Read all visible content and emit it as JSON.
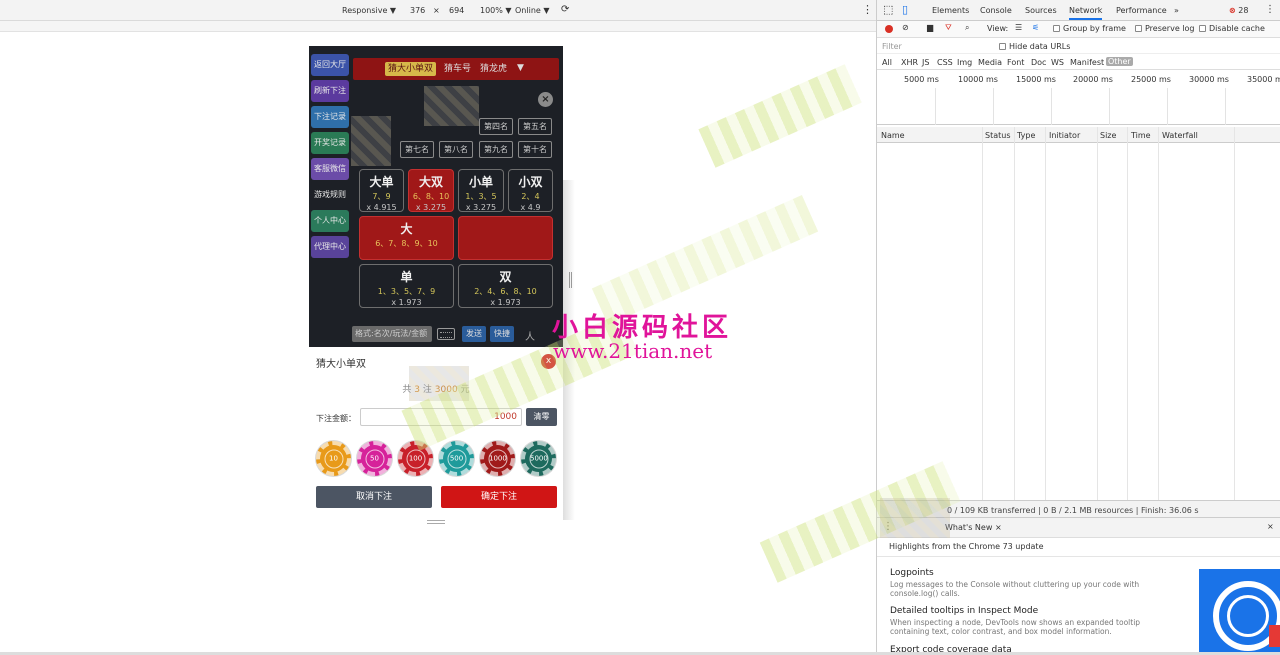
{
  "device_toolbar": {
    "mode": "Responsive ▼",
    "width": "376",
    "times": "×",
    "height": "694",
    "zoom": "100% ▼",
    "network": "Online ▼"
  },
  "game": {
    "side_menu": [
      "返回大厅",
      "刷新下注",
      "下注记录",
      "开奖记录",
      "客服微信",
      "游戏规则",
      "个人中心",
      "代理中心"
    ],
    "tabs": [
      "猜大小单双",
      "猜车号",
      "猜龙虎"
    ],
    "tab_caret": "▼",
    "close_label": "×",
    "ranks_row1": [
      "第四名",
      "第五名"
    ],
    "ranks_row2": [
      "第七名",
      "第八名",
      "第九名",
      "第十名"
    ],
    "cards": [
      {
        "title": "大单",
        "nums": "7、9",
        "odds": "x 4.915"
      },
      {
        "title": "大双",
        "nums": "6、8、10",
        "odds": "x 3.275"
      },
      {
        "title": "小单",
        "nums": "1、3、5",
        "odds": "x 3.275"
      },
      {
        "title": "小双",
        "nums": "2、4",
        "odds": "x 4.9"
      }
    ],
    "big": {
      "title": "大",
      "nums": "6、7、8、9、10",
      "odds": ""
    },
    "odd": {
      "title": "单",
      "nums": "1、3、5、7、9",
      "odds": "x 1.973"
    },
    "even": {
      "title": "双",
      "nums": "2、4、6、8、10",
      "odds": "x 1.973"
    },
    "input_placeholder": "格式:名次/玩法/金额",
    "send_label": "发送",
    "quick_label": "快捷",
    "person_icon": "人"
  },
  "sheet": {
    "title": "猜大小单双",
    "close_label": "x",
    "summary_prefix": "共",
    "summary_count": "3",
    "summary_mid": "注",
    "summary_amount": "3000",
    "summary_suffix": "元",
    "amount_label": "下注金额：",
    "amount_value": "1000",
    "clear_label": "清零",
    "chips": [
      {
        "label": "10",
        "color": "#e89a1a"
      },
      {
        "label": "50",
        "color": "#d6229a"
      },
      {
        "label": "100",
        "color": "#c8202a"
      },
      {
        "label": "500",
        "color": "#1f9b9b"
      },
      {
        "label": "1000",
        "color": "#a01a1a"
      },
      {
        "label": "5000",
        "color": "#1e6a5e"
      }
    ],
    "cancel_label": "取消下注",
    "confirm_label": "确定下注"
  },
  "devtools": {
    "tabs": [
      "Elements",
      "Console",
      "Sources",
      "Network",
      "Performance",
      "»"
    ],
    "error_count": "28",
    "view_label": "View:",
    "group_by_frame": "Group by frame",
    "preserve_log": "Preserve log",
    "disable_cache": "Disable cache",
    "filter_placeholder": "Filter",
    "hide_data_urls": "Hide data URLs",
    "types": [
      "All",
      "XHR",
      "JS",
      "CSS",
      "Img",
      "Media",
      "Font",
      "Doc",
      "WS",
      "Manifest",
      "Other"
    ],
    "timeline_ticks": [
      "5000 ms",
      "10000 ms",
      "15000 ms",
      "20000 ms",
      "25000 ms",
      "30000 ms",
      "35000 ms"
    ],
    "columns": [
      "Name",
      "Status",
      "Type",
      "Initiator",
      "Size",
      "Time",
      "Waterfall"
    ],
    "status_text": "0 / 109 KB transferred | 0 B / 2.1 MB resources | Finish: 36.06 s",
    "drawer_tab": "What's New",
    "drawer_tab_close": "×",
    "highlights": "Highlights from the Chrome 73 update",
    "features": [
      {
        "title": "Logpoints",
        "desc": "Log messages to the Console without cluttering up your code with console.log() calls."
      },
      {
        "title": "Detailed tooltips in Inspect Mode",
        "desc": "When inspecting a node, DevTools now shows an expanded tooltip containing text, color contrast, and box model information."
      },
      {
        "title": "Export code coverage data",
        "desc": ""
      }
    ]
  },
  "watermark": {
    "name": "小白源码社区",
    "url": "www.21tian.net"
  }
}
